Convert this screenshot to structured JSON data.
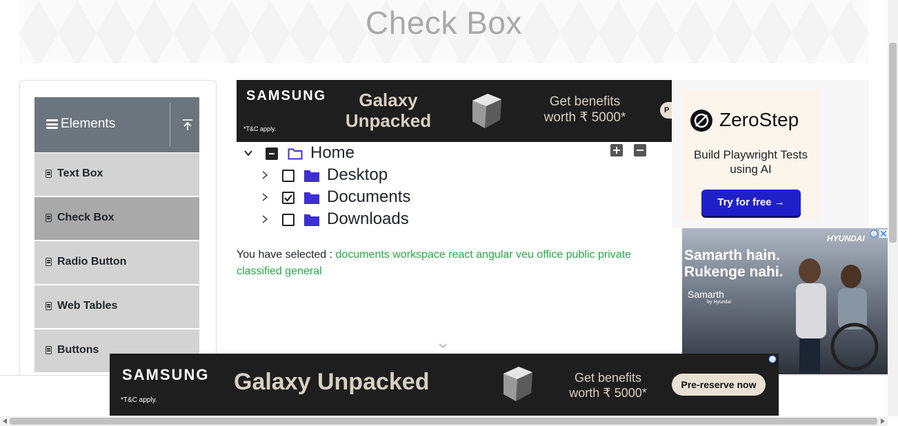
{
  "header": {
    "title": "Check Box"
  },
  "sidebar": {
    "group_title": "Elements",
    "items": [
      {
        "label": "Text Box",
        "active": false
      },
      {
        "label": "Check Box",
        "active": true
      },
      {
        "label": "Radio Button",
        "active": false
      },
      {
        "label": "Web Tables",
        "active": false
      },
      {
        "label": "Buttons",
        "active": false
      }
    ]
  },
  "tree": {
    "root": {
      "label": "Home",
      "state": "partial",
      "expanded": true
    },
    "children": [
      {
        "label": "Desktop",
        "checked": false,
        "expanded": false
      },
      {
        "label": "Documents",
        "checked": true,
        "expanded": false
      },
      {
        "label": "Downloads",
        "checked": false,
        "expanded": false
      }
    ],
    "expand_all_icon": "plus-square-icon",
    "collapse_all_icon": "minus-square-icon"
  },
  "result": {
    "prefix": "You have selected :",
    "items": [
      "documents",
      "workspace",
      "react",
      "angular",
      "veu",
      "office",
      "public",
      "private",
      "classified",
      "general"
    ]
  },
  "ads": {
    "top_samsung": {
      "brand": "SAMSUNG",
      "headline": "Galaxy Unpacked",
      "offer": "Get benefits worth ₹ 5000*",
      "terms": "*T&C apply.",
      "cut_button": "P"
    },
    "zerostep": {
      "name": "ZeroStep",
      "tagline": "Build Playwright Tests using AI",
      "cta": "Try for free →"
    },
    "hyundai": {
      "headline_1": "Samarth hain.",
      "headline_2": "Rukenge nahi.",
      "brand": "HYUNDAI",
      "sub_brand": "Samarth",
      "sub_brand_small": "by Hyundai"
    },
    "bottom_samsung": {
      "brand": "SAMSUNG",
      "headline": "Galaxy Unpacked",
      "offer": "Get benefits worth ₹ 5000*",
      "terms": "*T&C apply.",
      "cta": "Pre-reserve now"
    }
  },
  "colors": {
    "accent_green": "#28a745",
    "sidebar_header": "#6c757d",
    "sidebar_item": "#d3d3d3",
    "sidebar_active": "#a9a9a9",
    "folder": "#3d2ed6"
  }
}
